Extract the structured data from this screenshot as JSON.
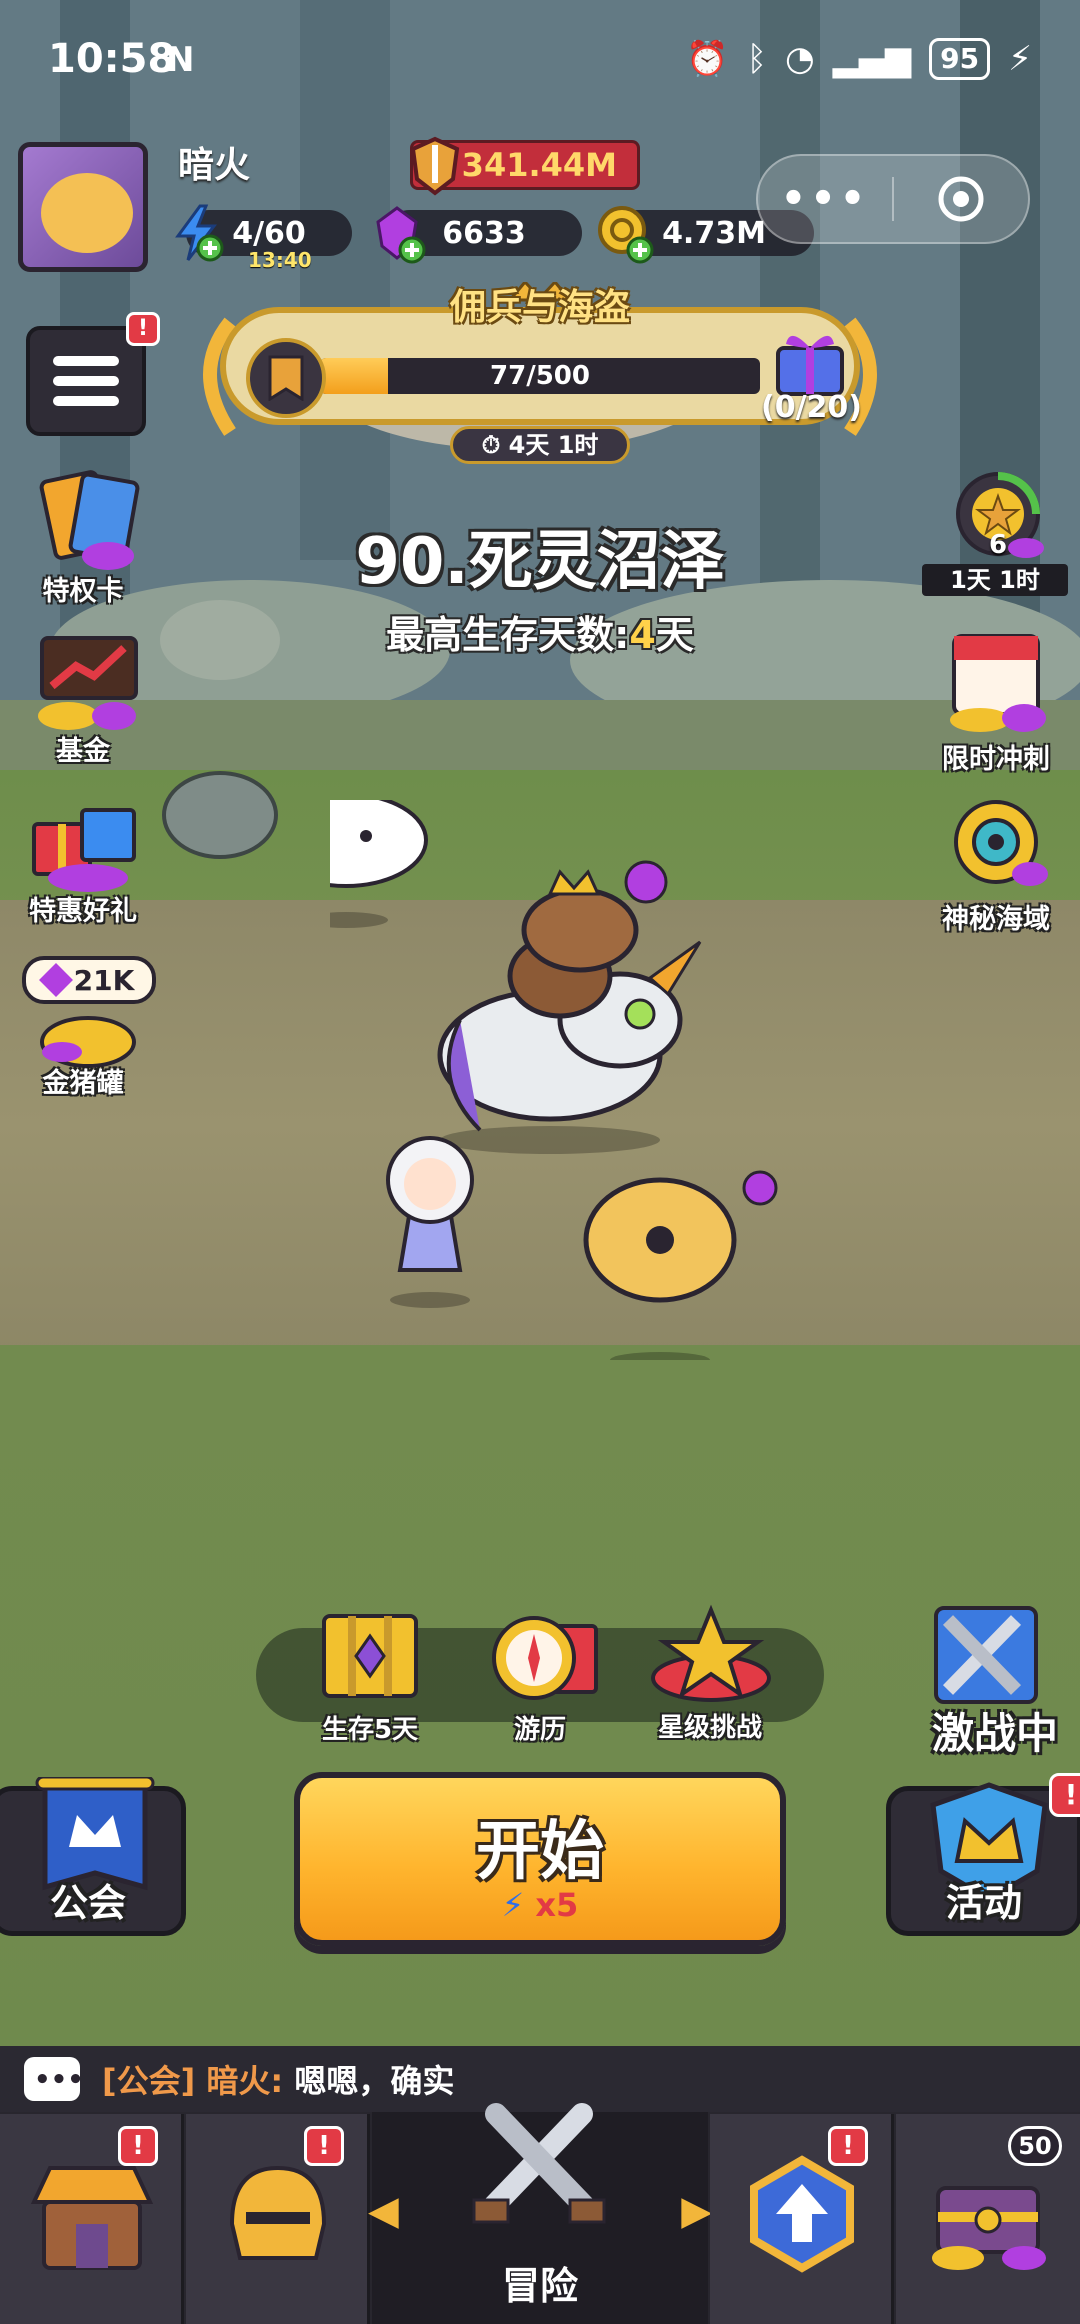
{
  "status_bar": {
    "time": "10:58",
    "battery": "95",
    "icons": [
      "nfc-icon",
      "alarm-icon",
      "bluetooth-icon",
      "wifi-icon",
      "signal-icon",
      "battery-icon",
      "charging-icon"
    ]
  },
  "player": {
    "name": "暗火",
    "power": "341.44M",
    "energy": "4/60",
    "energy_timer": "13:40",
    "gems": "6633",
    "gold": "4.73M"
  },
  "mini_program": {
    "more": "•••"
  },
  "event": {
    "title": "佣兵与海盗",
    "progress_text": "77/500",
    "progress_value": 77,
    "progress_max": 500,
    "gift_count": "(0/20)",
    "timer": "4天 1时"
  },
  "level": {
    "title": "90.死灵沼泽",
    "best_label": "最高生存天数:",
    "best_value": "4",
    "best_unit": "天"
  },
  "left_menu": {
    "badge": "!",
    "items": [
      {
        "label": "特权卡"
      },
      {
        "label": "基金"
      },
      {
        "label": "特惠好礼"
      },
      {
        "label": "金猪罐",
        "tag": "21K"
      }
    ]
  },
  "right_menu": {
    "items": [
      {
        "label": "1天 1时",
        "count": "6"
      },
      {
        "label": "限时冲刺"
      },
      {
        "label": "神秘海域"
      }
    ]
  },
  "actions": {
    "items": [
      {
        "label": "生存5天"
      },
      {
        "label": "游历"
      },
      {
        "label": "星级挑战"
      }
    ],
    "battle": "激战中"
  },
  "start_button": {
    "label": "开始",
    "cost": "x5"
  },
  "guild_button": {
    "label": "公会"
  },
  "activity_button": {
    "label": "活动",
    "badge": "!"
  },
  "chat": {
    "channel": "[公会]",
    "sender": "暗火:",
    "message": "嗯嗯，确实"
  },
  "bottom_nav": {
    "center_label": "冒险",
    "badges": [
      "!",
      "!",
      "!"
    ],
    "chest_count": "50"
  },
  "colors": {
    "accent_gold": "#ffb52e",
    "alert_red": "#e23a45",
    "gem_purple": "#b13fe0"
  }
}
